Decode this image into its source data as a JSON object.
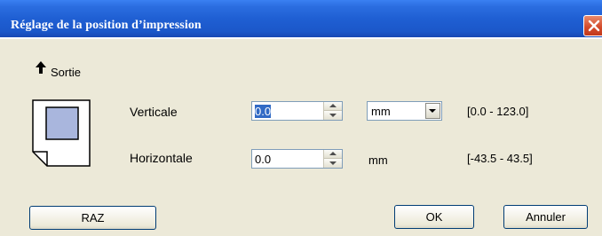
{
  "window": {
    "title": "Réglage de la position d’impression",
    "close_icon": "close-icon"
  },
  "output": {
    "icon": "up-arrow-icon",
    "label": "Sortie"
  },
  "vertical": {
    "label": "Verticale",
    "value": "0.0",
    "unit_options_selected": "mm",
    "range": "[0.0 - 123.0]"
  },
  "horizontal": {
    "label": "Horizontale",
    "value": "0.0",
    "unit": "mm",
    "range": "[-43.5 - 43.5]"
  },
  "buttons": {
    "reset": "RAZ",
    "ok": "OK",
    "cancel": "Annuler"
  },
  "colors": {
    "titlebar": "#1f5fd3",
    "selection": "#316ac5",
    "paper_preview": "#a9b6dd"
  }
}
